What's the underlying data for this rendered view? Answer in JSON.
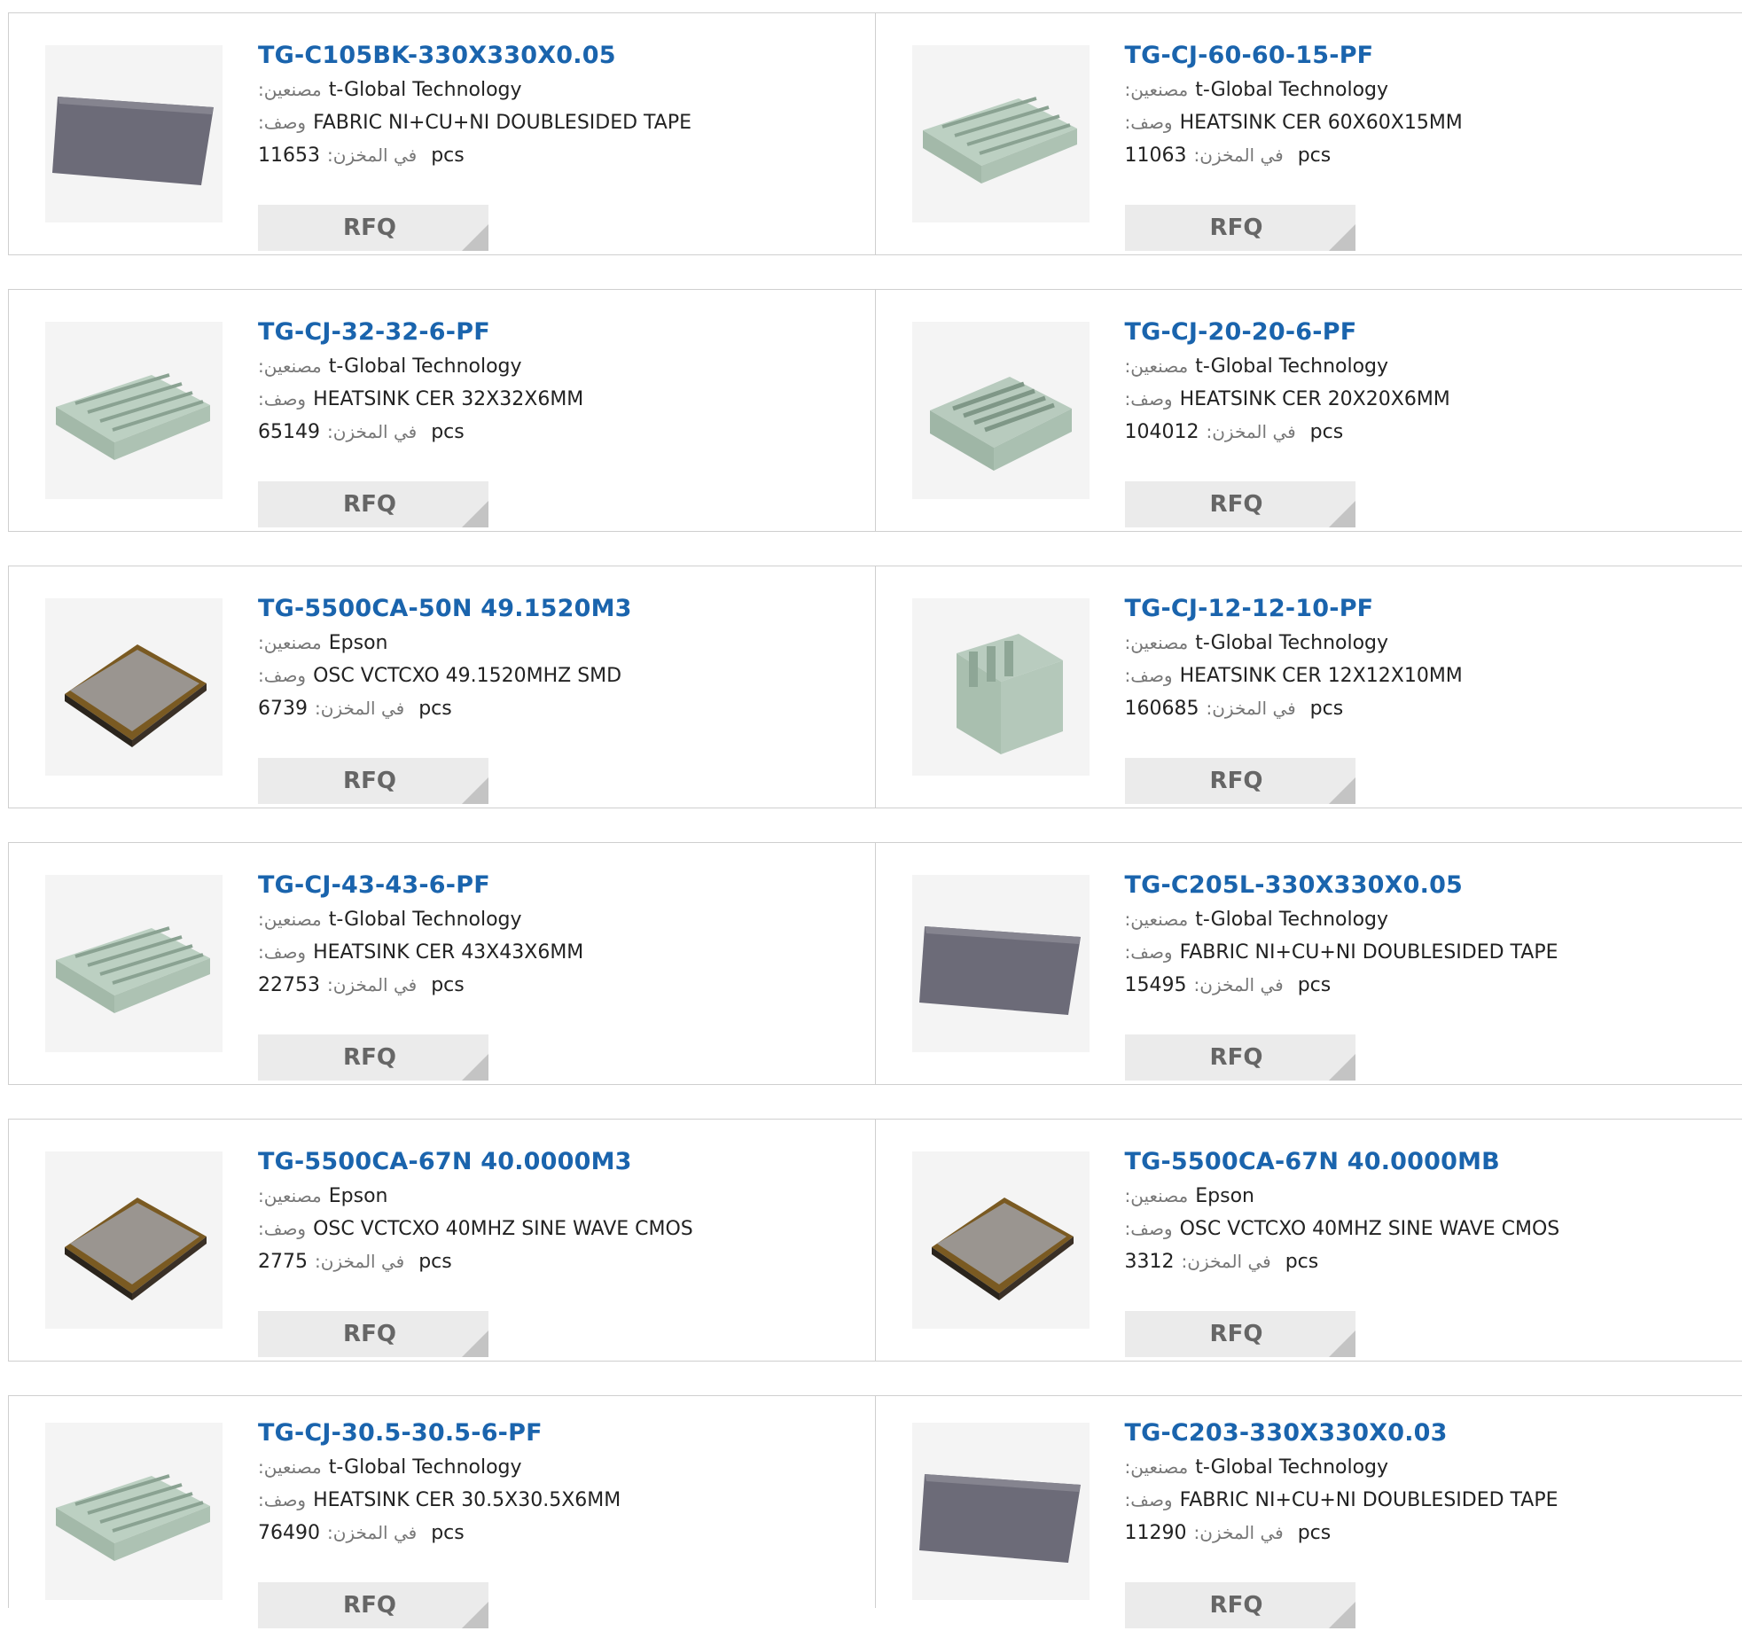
{
  "labels": {
    "manufacturer": ":مصنعين",
    "description": ":وصف",
    "stock": ":في المخزن",
    "unit": "pcs",
    "rfq": "RFQ"
  },
  "products": [
    {
      "part": "TG-C105BK-330X330X0.05",
      "manufacturer": "t-Global Technology",
      "description": "FABRIC NI+CU+NI DOUBLESIDED TAPE",
      "stock": "11653",
      "image": "sheet-image"
    },
    {
      "part": "TG-CJ-60-60-15-PF",
      "manufacturer": "t-Global Technology",
      "description": "HEATSINK CER 60X60X15MM",
      "stock": "11063",
      "image": "heatsink-image"
    },
    {
      "part": "TG-CJ-32-32-6-PF",
      "manufacturer": "t-Global Technology",
      "description": "HEATSINK CER 32X32X6MM",
      "stock": "65149",
      "image": "heatsink-image"
    },
    {
      "part": "TG-CJ-20-20-6-PF",
      "manufacturer": "t-Global Technology",
      "description": "HEATSINK CER 20X20X6MM",
      "stock": "104012",
      "image": "heatsink-grid-image"
    },
    {
      "part": "TG-5500CA-50N 49.1520M3",
      "manufacturer": "Epson",
      "description": "OSC VCTCXO 49.1520MHZ SMD",
      "stock": "6739",
      "image": "oscillator-image"
    },
    {
      "part": "TG-CJ-12-12-10-PF",
      "manufacturer": "t-Global Technology",
      "description": "HEATSINK CER 12X12X10MM",
      "stock": "160685",
      "image": "heatsink-block-image"
    },
    {
      "part": "TG-CJ-43-43-6-PF",
      "manufacturer": "t-Global Technology",
      "description": "HEATSINK CER 43X43X6MM",
      "stock": "22753",
      "image": "heatsink-image"
    },
    {
      "part": "TG-C205L-330X330X0.05",
      "manufacturer": "t-Global Technology",
      "description": "FABRIC NI+CU+NI DOUBLESIDED TAPE",
      "stock": "15495",
      "image": "sheet-image"
    },
    {
      "part": "TG-5500CA-67N 40.0000M3",
      "manufacturer": "Epson",
      "description": "OSC VCTCXO 40MHZ SINE WAVE CMOS",
      "stock": "2775",
      "image": "oscillator-image"
    },
    {
      "part": "TG-5500CA-67N 40.0000MB",
      "manufacturer": "Epson",
      "description": "OSC VCTCXO 40MHZ SINE WAVE CMOS",
      "stock": "3312",
      "image": "oscillator-image"
    },
    {
      "part": "TG-CJ-30.5-30.5-6-PF",
      "manufacturer": "t-Global Technology",
      "description": "HEATSINK CER 30.5X30.5X6MM",
      "stock": "76490",
      "image": "heatsink-image"
    },
    {
      "part": "TG-C203-330X330X0.03",
      "manufacturer": "t-Global Technology",
      "description": "FABRIC NI+CU+NI DOUBLESIDED TAPE",
      "stock": "11290",
      "image": "sheet-image"
    }
  ]
}
